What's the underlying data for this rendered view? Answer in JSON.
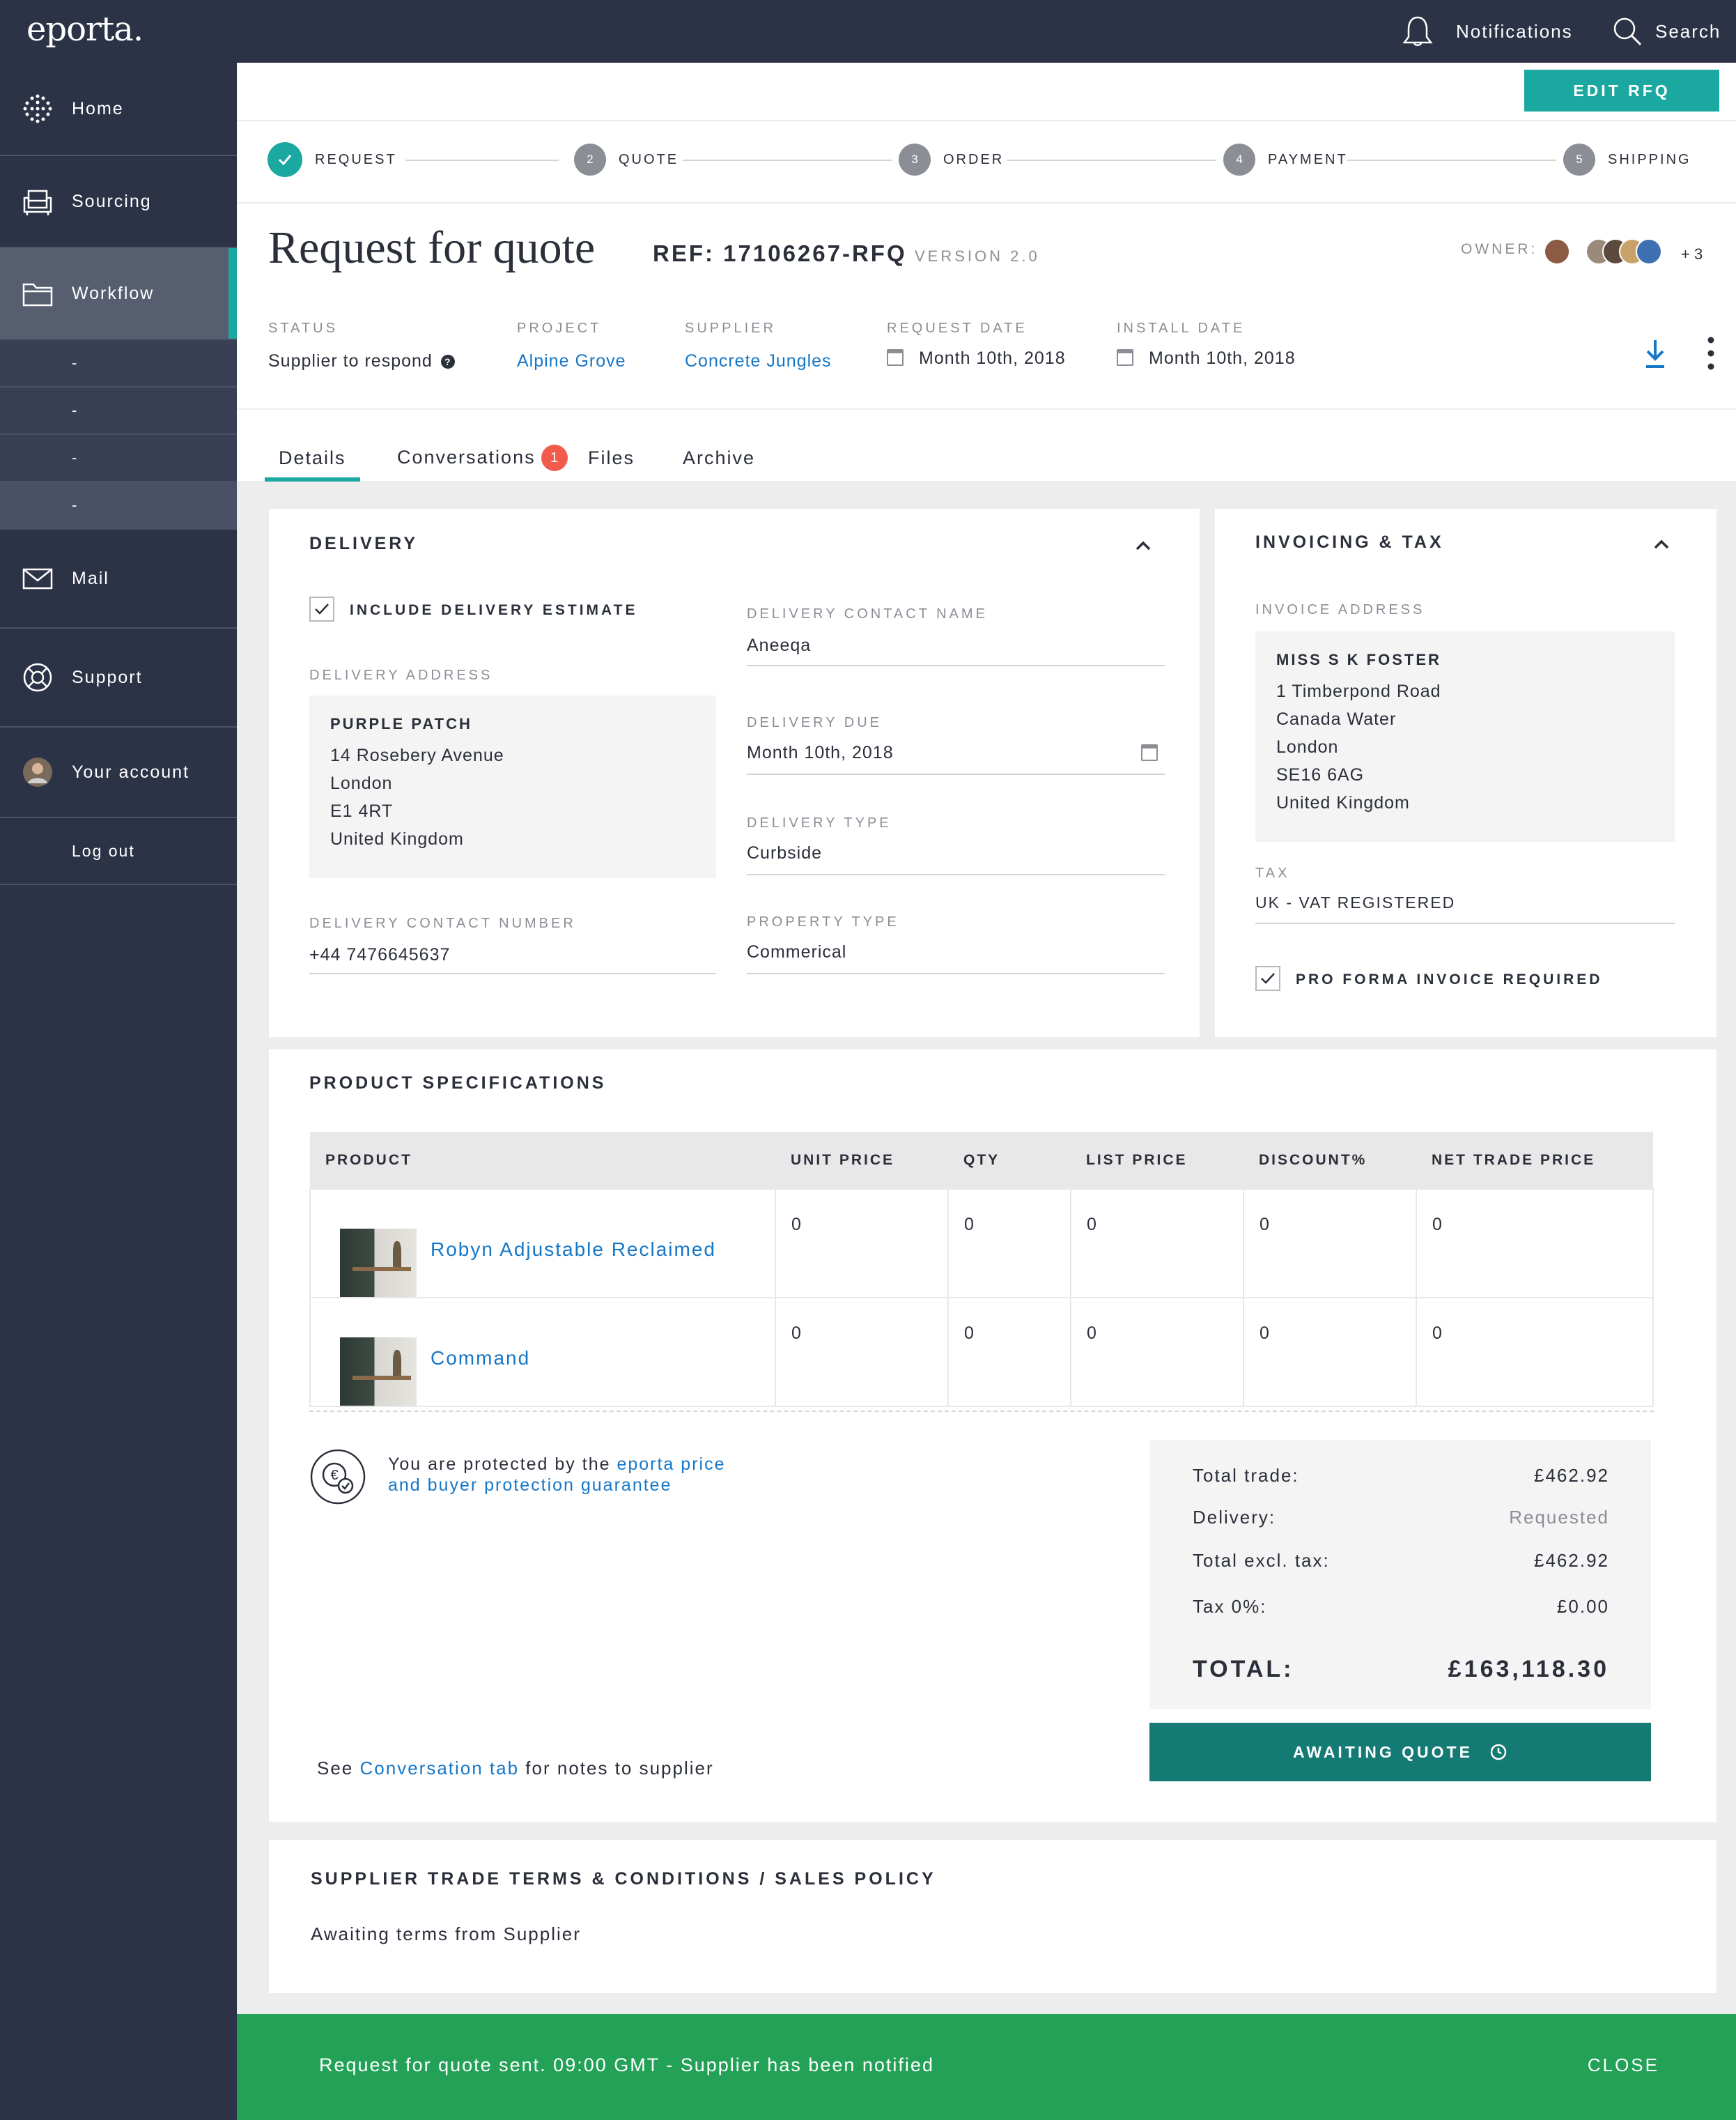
{
  "app": {
    "logo": "eporta."
  },
  "topbar": {
    "notifications": "Notifications",
    "search": "Search"
  },
  "sidebar": {
    "items": [
      {
        "label": "Home",
        "icon": "globe-icon"
      },
      {
        "label": "Sourcing",
        "icon": "armchair-icon"
      },
      {
        "label": "Workflow",
        "icon": "folder-icon"
      },
      {
        "label": "Mail",
        "icon": "envelope-icon"
      },
      {
        "label": "Support",
        "icon": "lifebuoy-icon"
      },
      {
        "label": "Your account",
        "icon": "avatar"
      },
      {
        "label": "Log out"
      }
    ],
    "sub_items": [
      "-",
      "-",
      "-",
      "-"
    ]
  },
  "actions": {
    "edit_rfq": "EDIT RFQ"
  },
  "steps": [
    {
      "num": "",
      "label": "REQUEST",
      "done": true
    },
    {
      "num": "2",
      "label": "QUOTE"
    },
    {
      "num": "3",
      "label": "ORDER"
    },
    {
      "num": "4",
      "label": "PAYMENT"
    },
    {
      "num": "5",
      "label": "SHIPPING"
    }
  ],
  "header": {
    "title": "Request for quote",
    "ref": "REF: 17106267-RFQ",
    "version": "VERSION 2.0",
    "owner_label": "OWNER:",
    "owner_extra": "+ 3"
  },
  "meta": {
    "status_label": "STATUS",
    "status": "Supplier to respond",
    "project_label": "PROJECT",
    "project": "Alpine Grove",
    "supplier_label": "SUPPLIER",
    "supplier": "Concrete Jungles",
    "request_date_label": "REQUEST DATE",
    "request_date": "Month 10th, 2018",
    "install_date_label": "INSTALL DATE",
    "install_date": "Month 10th, 2018"
  },
  "tabs": {
    "details": "Details",
    "conversations": "Conversations",
    "conversations_badge": "1",
    "files": "Files",
    "archive": "Archive"
  },
  "delivery": {
    "title": "DELIVERY",
    "include_estimate": "INCLUDE DELIVERY ESTIMATE",
    "address_label": "DELIVERY ADDRESS",
    "address": {
      "name": "PURPLE PATCH",
      "lines": [
        "14 Rosebery Avenue",
        "London",
        "E1 4RT",
        "United Kingdom"
      ]
    },
    "contact_number_label": "DELIVERY CONTACT NUMBER",
    "contact_number": "+44 7476645637",
    "contact_name_label": "DELIVERY CONTACT NAME",
    "contact_name": "Aneeqa",
    "due_label": "DELIVERY DUE",
    "due": "Month 10th, 2018",
    "type_label": "DELIVERY TYPE",
    "type": "Curbside",
    "property_label": "PROPERTY TYPE",
    "property": "Commerical"
  },
  "invoicing": {
    "title": "INVOICING & TAX",
    "address_label": "INVOICE ADDRESS",
    "address": {
      "name": "MISS S K FOSTER",
      "lines": [
        "1 Timberpond Road",
        "Canada Water",
        "London",
        "SE16 6AG",
        "United Kingdom"
      ]
    },
    "tax_label": "TAX",
    "tax": "UK - VAT REGISTERED",
    "pro_forma": "PRO FORMA INVOICE REQUIRED"
  },
  "products": {
    "title": "PRODUCT SPECIFICATIONS",
    "columns": [
      "PRODUCT",
      "UNIT PRICE",
      "QTY",
      "LIST PRICE",
      "DISCOUNT%",
      "NET TRADE PRICE"
    ],
    "rows": [
      {
        "name": "Robyn Adjustable Reclaimed",
        "values": [
          "0",
          "0",
          "0",
          "0",
          "0"
        ]
      },
      {
        "name": "Command",
        "values": [
          "0",
          "0",
          "0",
          "0",
          "0"
        ]
      }
    ]
  },
  "protection": {
    "prefix": "You are protected by the",
    "link1": "eporta price",
    "link2": "and buyer protection guarantee"
  },
  "totals": {
    "rows": [
      {
        "label": "Total trade:",
        "value": "£462.92"
      },
      {
        "label": "Delivery:",
        "value": "Requested"
      },
      {
        "label": "Total excl. tax:",
        "value": "£462.92"
      },
      {
        "label": "Tax 0%:",
        "value": "£0.00"
      }
    ],
    "total_label": "TOTAL:",
    "total_value": "£163,118.30"
  },
  "awaiting_button": "AWAITING QUOTE",
  "notes": {
    "prefix": "See",
    "link": "Conversation tab",
    "suffix": "for notes to supplier"
  },
  "terms": {
    "title": "SUPPLIER TRADE TERMS & CONDITIONS / SALES POLICY",
    "body": "Awaiting terms from Supplier"
  },
  "toast": {
    "message": "Request for quote sent. 09:00 GMT - Supplier has been notified",
    "close": "CLOSE"
  },
  "colors": {
    "accent": "#1aa8a0",
    "sidebar": "#2d3347",
    "link": "#1677c7",
    "success": "#22a157",
    "badge": "#f15b4c",
    "button_dark": "#137a74"
  }
}
